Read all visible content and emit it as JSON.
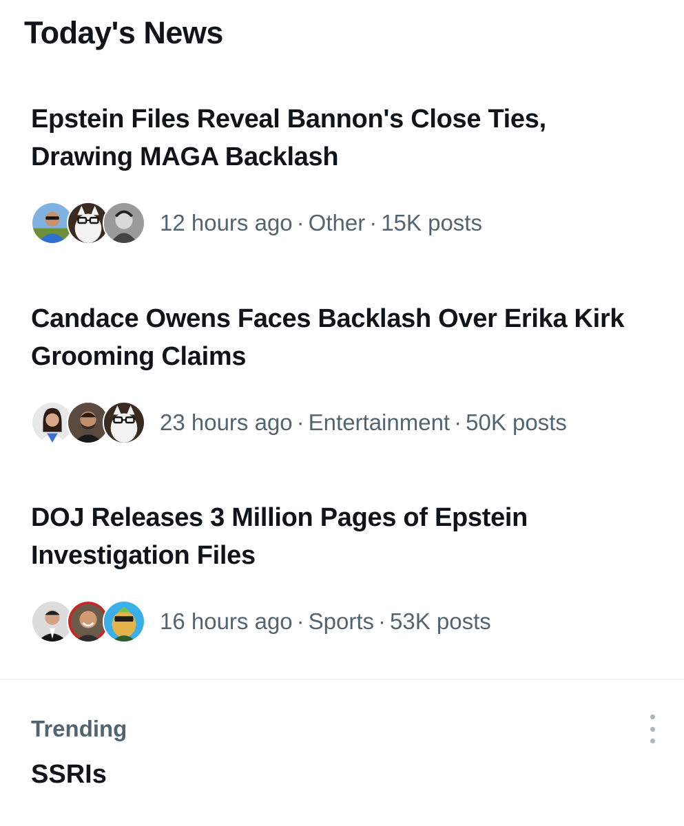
{
  "section": {
    "title": "Today's News"
  },
  "news": [
    {
      "headline": "Epstein Files Reveal Bannon's Close Ties, Drawing MAGA Backlash",
      "time": "12 hours ago",
      "category": "Other",
      "posts": "15K posts"
    },
    {
      "headline": "Candace Owens Faces Backlash Over Erika Kirk Grooming Claims",
      "time": "23 hours ago",
      "category": "Entertainment",
      "posts": "50K posts"
    },
    {
      "headline": "DOJ Releases 3 Million Pages of Epstein Investigation Files",
      "time": "16 hours ago",
      "category": "Sports",
      "posts": "53K posts"
    }
  ],
  "separator": "·",
  "trending": {
    "label": "Trending",
    "name": "SSRIs",
    "more_icon": "more-vertical-icon"
  },
  "colors": {
    "text_primary": "#0f1419",
    "text_secondary": "#536471",
    "divider": "#eff3f4"
  }
}
